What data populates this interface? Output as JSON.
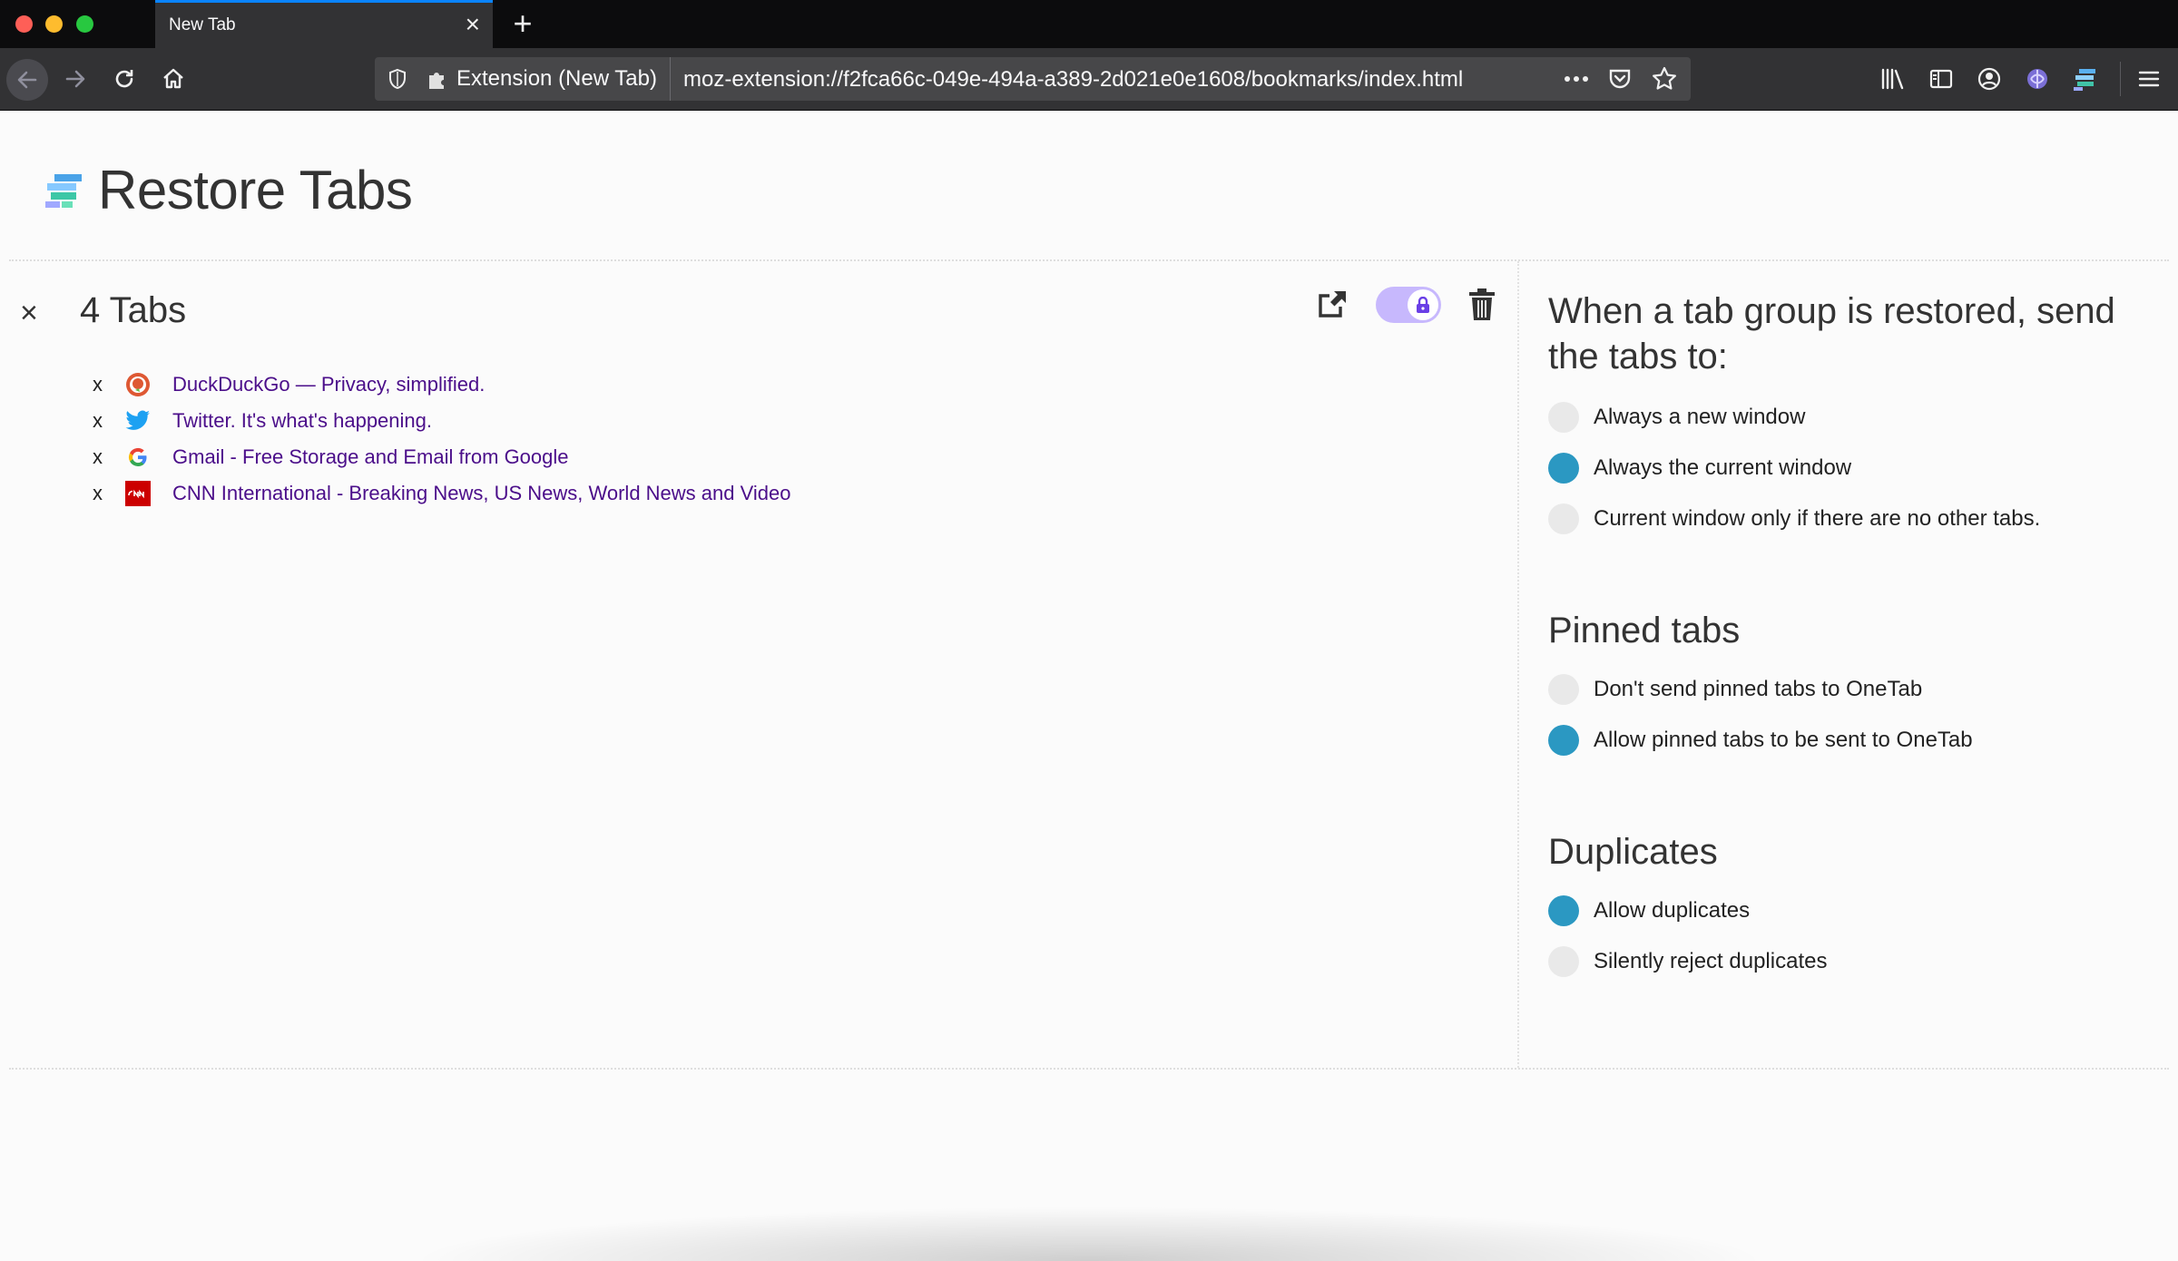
{
  "browser": {
    "tab": {
      "title": "New Tab"
    },
    "url": {
      "identity": "Extension (New Tab)",
      "address": "moz-extension://f2fca66c-049e-494a-a389-2d021e0e1608/bookmarks/index.html"
    },
    "icons": [
      "back-arrow-icon",
      "forward-arrow-icon",
      "reload-icon",
      "home-icon",
      "shield-icon",
      "puzzle-icon",
      "more-icon",
      "pocket-icon",
      "star-icon",
      "library-icon",
      "sidebar-icon",
      "account-icon",
      "extension-icon",
      "restore-tabs-icon",
      "menu-icon"
    ]
  },
  "page": {
    "title": "Restore Tabs",
    "group": {
      "title": "4 Tabs",
      "remove_symbol": "×",
      "tabs": [
        {
          "remove": "x",
          "icon": "duckduckgo-favicon",
          "title": "DuckDuckGo — Privacy, simplified."
        },
        {
          "remove": "x",
          "icon": "twitter-favicon",
          "title": "Twitter. It's what's happening."
        },
        {
          "remove": "x",
          "icon": "google-favicon",
          "title": "Gmail - Free Storage and Email from Google"
        },
        {
          "remove": "x",
          "icon": "cnn-favicon",
          "title": "CNN International - Breaking News, US News, World News and Video"
        }
      ]
    }
  },
  "settings": {
    "restore": {
      "heading": "When a tab group is restored, send the tabs to:",
      "options": [
        {
          "label": "Always a new window",
          "selected": false
        },
        {
          "label": "Always the current window",
          "selected": true
        },
        {
          "label": "Current window only if there are no other tabs.",
          "selected": false
        }
      ]
    },
    "pinned": {
      "heading": "Pinned tabs",
      "options": [
        {
          "label": "Don't send pinned tabs to OneTab",
          "selected": false
        },
        {
          "label": "Allow pinned tabs to be sent to OneTab",
          "selected": true
        }
      ]
    },
    "duplicates": {
      "heading": "Duplicates",
      "options": [
        {
          "label": "Allow duplicates",
          "selected": true
        },
        {
          "label": "Silently reject duplicates",
          "selected": false
        }
      ]
    }
  },
  "colors": {
    "accent_radio": "#2b98c2",
    "toggle": "#c7b8fd",
    "link": "#4b0e8a"
  }
}
